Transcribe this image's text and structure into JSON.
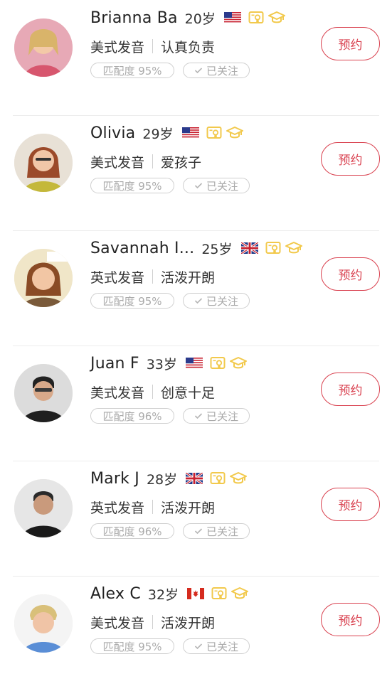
{
  "colors": {
    "accent": "#d9414f",
    "badge_gold": "#f2c94c",
    "tag_border": "#cfcfcf",
    "tag_text": "#aaaaaa"
  },
  "icons": {
    "cert_badge": "certificate-icon",
    "edu_badge": "graduation-cap-icon",
    "follow_check": "check-icon"
  },
  "teachers": [
    {
      "name": "Brianna Ba",
      "age": "20岁",
      "flag": "us",
      "accent": "美式发音",
      "trait": "认真负责",
      "match": "匹配度 95%",
      "follow": "已关注",
      "book": "预约"
    },
    {
      "name": "Olivia",
      "age": "29岁",
      "flag": "us",
      "accent": "美式发音",
      "trait": "爱孩子",
      "match": "匹配度 95%",
      "follow": "已关注",
      "book": "预约"
    },
    {
      "name": "Savannah I...",
      "age": "25岁",
      "flag": "uk",
      "accent": "英式发音",
      "trait": "活泼开朗",
      "match": "匹配度 95%",
      "follow": "已关注",
      "book": "预约"
    },
    {
      "name": "Juan F",
      "age": "33岁",
      "flag": "us",
      "accent": "美式发音",
      "trait": "创意十足",
      "match": "匹配度 96%",
      "follow": "已关注",
      "book": "预约"
    },
    {
      "name": "Mark J",
      "age": "28岁",
      "flag": "uk",
      "accent": "英式发音",
      "trait": "活泼开朗",
      "match": "匹配度 96%",
      "follow": "已关注",
      "book": "预约"
    },
    {
      "name": "Alex C",
      "age": "32岁",
      "flag": "ca",
      "accent": "美式发音",
      "trait": "活泼开朗",
      "match": "匹配度 95%",
      "follow": "已关注",
      "book": "预约"
    }
  ]
}
